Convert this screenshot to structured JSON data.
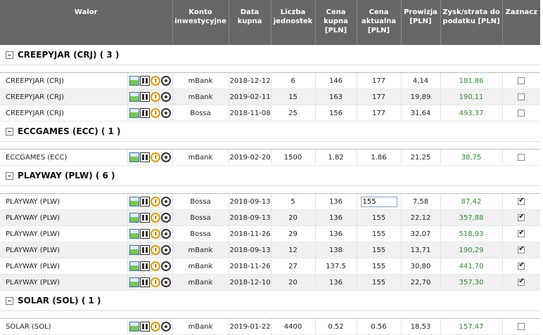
{
  "headers": {
    "walor": "Walor",
    "konto": "Konto inwestycyjne",
    "data": "Data kupna",
    "liczba": "Liczba jednostek",
    "kupna": "Cena kupna [PLN]",
    "aktualna": "Cena aktualna [PLN]",
    "prowizja": "Prowizja [PLN]",
    "zysk": "Zysk/strata do podatku [PLN]",
    "zaznacz": "Zaznacz"
  },
  "groups": [
    {
      "title": "CREEPYJAR (CRJ) ( 3 )",
      "rows": [
        {
          "name": "CREEPYJAR (CRJ)",
          "konto": "mBank",
          "data": "2018-12-12",
          "liczba": "6",
          "kupna": "146",
          "aktualna": "177",
          "prowizja": "4,14",
          "zysk": "181,86",
          "checked": false
        },
        {
          "name": "CREEPYJAR (CRJ)",
          "konto": "mBank",
          "data": "2019-02-11",
          "liczba": "15",
          "kupna": "163",
          "aktualna": "177",
          "prowizja": "19,89",
          "zysk": "190,11",
          "checked": false
        },
        {
          "name": "CREEPYJAR (CRJ)",
          "konto": "Bossa",
          "data": "2018-11-08",
          "liczba": "25",
          "kupna": "156",
          "aktualna": "177",
          "prowizja": "31,64",
          "zysk": "493,37",
          "checked": false
        }
      ]
    },
    {
      "title": "ECCGAMES (ECC) ( 1 )",
      "rows": [
        {
          "name": "ECCGAMES (ECC)",
          "konto": "mBank",
          "data": "2019-02-20",
          "liczba": "1500",
          "kupna": "1.82",
          "aktualna": "1.86",
          "prowizja": "21,25",
          "zysk": "38,75",
          "checked": false
        }
      ]
    },
    {
      "title": "PLAYWAY (PLW) ( 6 )",
      "rows": [
        {
          "name": "PLAYWAY (PLW)",
          "konto": "Bossa",
          "data": "2018-09-13",
          "liczba": "5",
          "kupna": "136",
          "aktualna": "155",
          "prowizja": "7,58",
          "zysk": "87,42",
          "checked": true,
          "editing": true
        },
        {
          "name": "PLAYWAY (PLW)",
          "konto": "Bossa",
          "data": "2018-09-13",
          "liczba": "20",
          "kupna": "136",
          "aktualna": "155",
          "prowizja": "22,12",
          "zysk": "357,88",
          "checked": true
        },
        {
          "name": "PLAYWAY (PLW)",
          "konto": "Bossa",
          "data": "2018-11-26",
          "liczba": "29",
          "kupna": "136",
          "aktualna": "155",
          "prowizja": "32,07",
          "zysk": "518,93",
          "checked": true
        },
        {
          "name": "PLAYWAY (PLW)",
          "konto": "mBank",
          "data": "2018-09-13",
          "liczba": "12",
          "kupna": "138",
          "aktualna": "155",
          "prowizja": "13,71",
          "zysk": "190,29",
          "checked": true
        },
        {
          "name": "PLAYWAY (PLW)",
          "konto": "mBank",
          "data": "2018-11-26",
          "liczba": "27",
          "kupna": "137.5",
          "aktualna": "155",
          "prowizja": "30,80",
          "zysk": "441,70",
          "checked": true
        },
        {
          "name": "PLAYWAY (PLW)",
          "konto": "mBank",
          "data": "2018-12-10",
          "liczba": "20",
          "kupna": "136",
          "aktualna": "155",
          "prowizja": "22,70",
          "zysk": "357,30",
          "checked": true
        }
      ]
    },
    {
      "title": "SOLAR (SOL) ( 1 )",
      "rows": [
        {
          "name": "SOLAR (SOL)",
          "konto": "mBank",
          "data": "2019-01-22",
          "liczba": "4400",
          "kupna": "0.52",
          "aktualna": "0.56",
          "prowizja": "18,53",
          "zysk": "157,47",
          "checked": false
        }
      ]
    }
  ],
  "row_icons": [
    "chart-icon",
    "binoculars-icon",
    "clock-icon",
    "eye-icon"
  ],
  "colors": {
    "header_bg": "#676767",
    "gain": "#2e8b2e"
  }
}
